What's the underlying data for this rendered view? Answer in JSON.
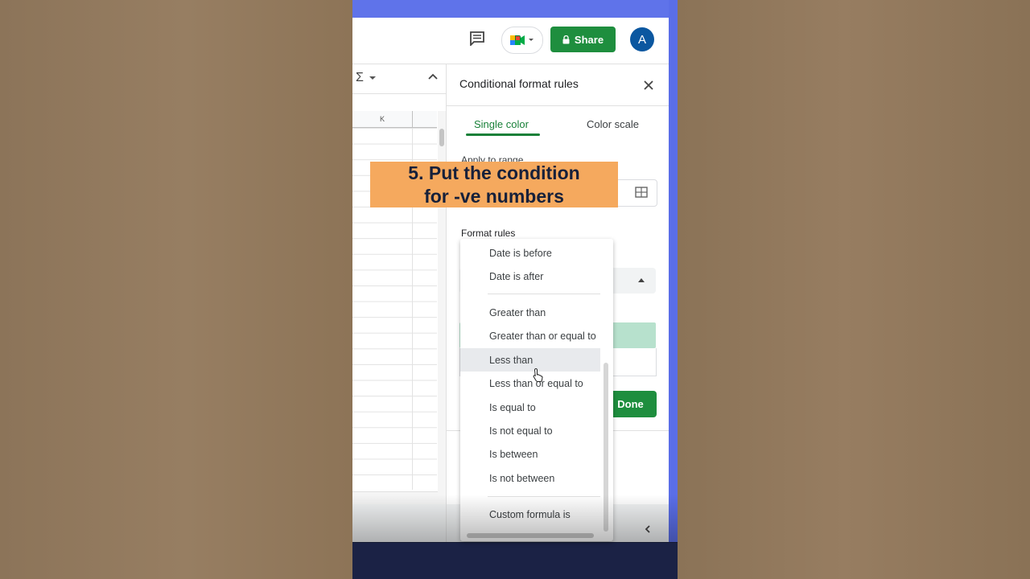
{
  "header": {
    "share_label": "Share",
    "avatar_initial": "A"
  },
  "sheet": {
    "column_label": "K",
    "sum_symbol": "Σ"
  },
  "panel": {
    "title": "Conditional format rules",
    "tabs": [
      {
        "label": "Single color",
        "active": true
      },
      {
        "label": "Color scale",
        "active": false
      }
    ],
    "apply_to_range_label": "Apply to range",
    "format_rules_label": "Format rules",
    "done_label": "Done"
  },
  "dropdown": {
    "items": [
      {
        "label": "Date is before"
      },
      {
        "label": "Date is after"
      },
      {
        "label": "Greater than"
      },
      {
        "label": "Greater than or equal to"
      },
      {
        "label": "Less than",
        "highlighted": true
      },
      {
        "label": "Less than or equal to"
      },
      {
        "label": "Is equal to"
      },
      {
        "label": "Is not equal to"
      },
      {
        "label": "Is between"
      },
      {
        "label": "Is not between"
      },
      {
        "label": "Custom formula is"
      }
    ]
  },
  "caption": {
    "line1": "5. Put the condition",
    "line2": "for -ve numbers"
  },
  "colors": {
    "accent_green": "#1e8e3e",
    "preview_green": "#b7e1cd",
    "caption_bg": "#f5a95e",
    "avatar_blue": "#0b57a0",
    "frame_blue": "#5a6ee8"
  }
}
